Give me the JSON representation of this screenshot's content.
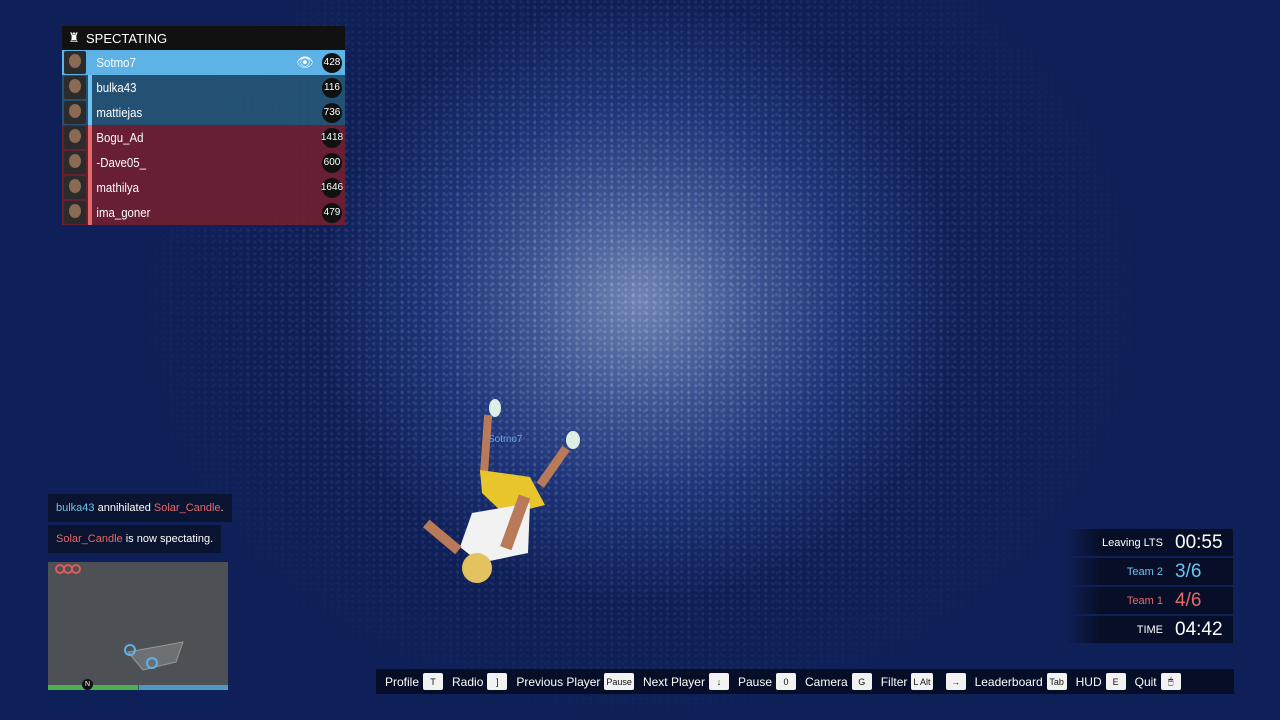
{
  "spectating": {
    "title": "SPECTATING",
    "players": [
      {
        "name": "Sotmo7",
        "score": "428",
        "team": "selected",
        "spectated": true
      },
      {
        "name": "bulka43",
        "score": "116",
        "team": "team2"
      },
      {
        "name": "mattiejas",
        "score": "736",
        "team": "team2"
      },
      {
        "name": "Bogu_Ad",
        "score": "1418",
        "team": "team1"
      },
      {
        "name": "-Dave05_",
        "score": "600",
        "team": "team1"
      },
      {
        "name": "mathilya",
        "score": "1646",
        "team": "team1"
      },
      {
        "name": "ima_goner",
        "score": "479",
        "team": "team1"
      }
    ]
  },
  "feed": [
    {
      "actor": "bulka43",
      "action": "annihilated",
      "target": "Solar_Candle",
      "end": "."
    },
    {
      "actor": "Solar_Candle",
      "action": "is now spectating."
    }
  ],
  "player_tag": "Sotmo7",
  "hud": {
    "leaving_label": "Leaving LTS",
    "leaving_time": "00:55",
    "team2_label": "Team 2",
    "team2_score": "3/6",
    "team1_label": "Team 1",
    "team1_score": "4/6",
    "time_label": "TIME",
    "time_value": "04:42"
  },
  "minimap": {
    "north": "N"
  },
  "help": [
    {
      "label": "Profile",
      "key": "T"
    },
    {
      "label": "Radio",
      "key": "]"
    },
    {
      "label": "Previous Player",
      "key": "Pause"
    },
    {
      "label": "Next Player",
      "key": "↓"
    },
    {
      "label": "Pause",
      "key": "0"
    },
    {
      "label": "Camera",
      "key": "G"
    },
    {
      "label": "Filter",
      "key": "L Alt"
    },
    {
      "label": "",
      "key": "→"
    },
    {
      "label": "Leaderboard",
      "key": "Tab"
    },
    {
      "label": "HUD",
      "key": "E"
    },
    {
      "label": "Quit",
      "key": "🖱"
    }
  ],
  "colors": {
    "team2": "#6ec3f2",
    "team1": "#e56a6a",
    "selected": "#5db3e6"
  }
}
